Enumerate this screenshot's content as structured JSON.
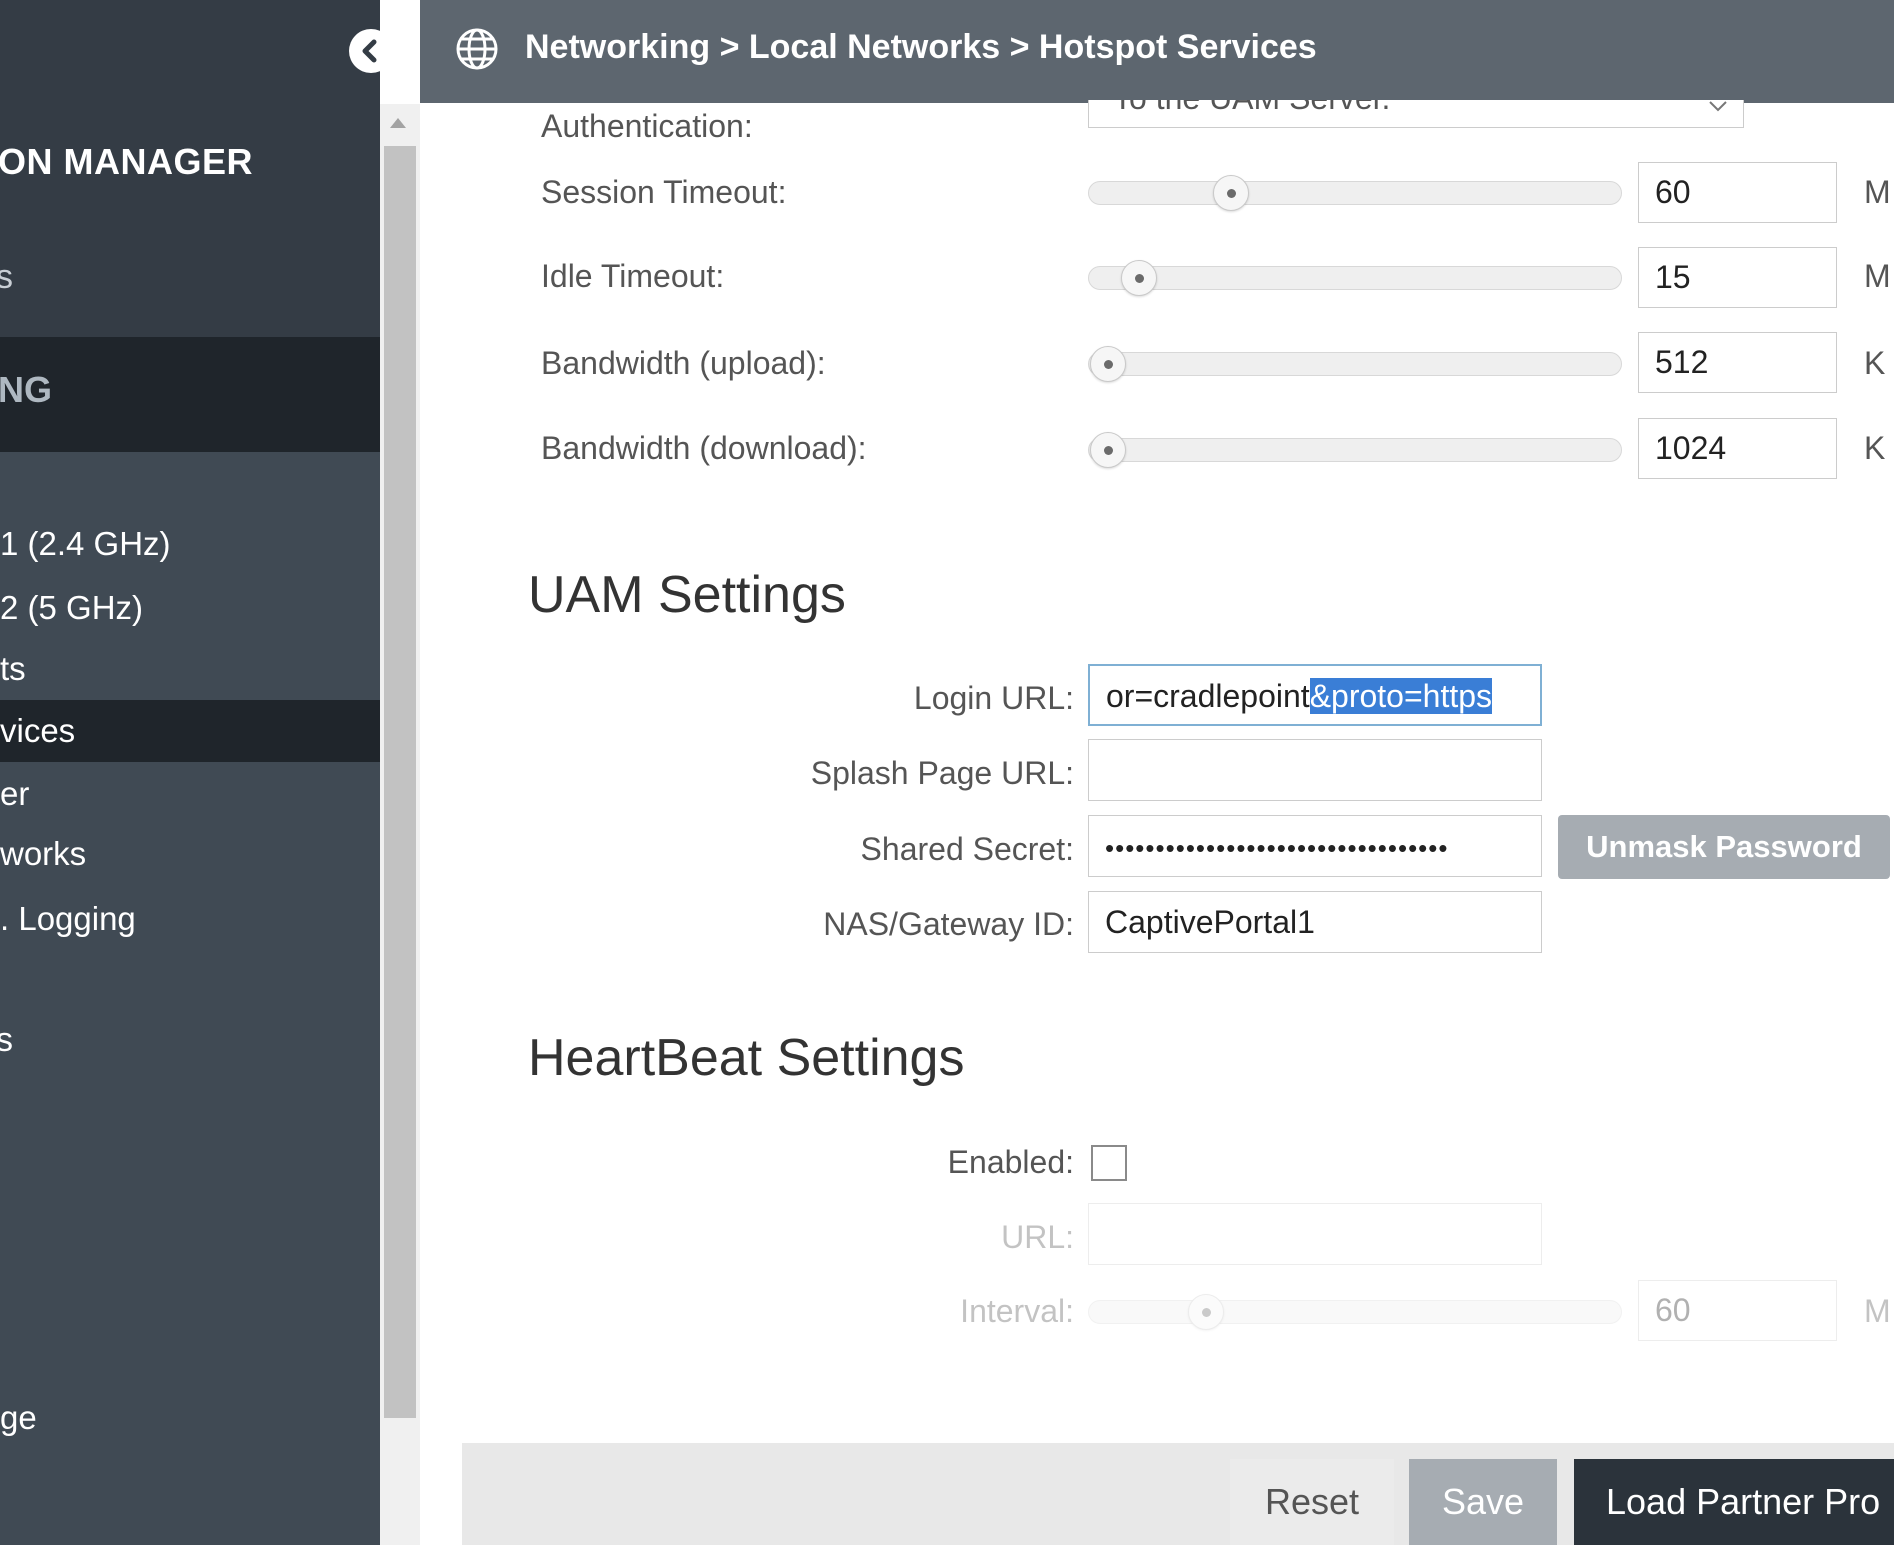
{
  "sidebar": {
    "app_title": "ON MANAGER",
    "fragment_top": "s",
    "section": "NG",
    "items": [
      {
        "label": "1 (2.4 GHz)",
        "active": false
      },
      {
        "label": "2 (5 GHz)",
        "active": false
      },
      {
        "label": "ts",
        "active": false
      },
      {
        "label": "vices",
        "active": true
      },
      {
        "label": "er",
        "active": false
      },
      {
        "label": "works",
        "active": false
      },
      {
        "label": ". Logging",
        "active": false
      }
    ],
    "fragment_mid": "s",
    "fragment_bottom": "ge"
  },
  "header": {
    "breadcrumb": "Networking > Local Networks > Hotspot Services"
  },
  "auth": {
    "label": "Authentication:",
    "select_value": "To the UAM Server."
  },
  "sliders": [
    {
      "label": "Session Timeout:",
      "value": "60",
      "unit": "M",
      "level": 0.27
    },
    {
      "label": "Idle Timeout:",
      "value": "15",
      "unit": "M",
      "level": 0.09
    },
    {
      "label": "Bandwidth (upload):",
      "value": "512",
      "unit": "K",
      "level": 0.03
    },
    {
      "label": "Bandwidth (download):",
      "value": "1024",
      "unit": "K",
      "level": 0.03
    }
  ],
  "uam": {
    "heading": "UAM Settings",
    "login_url_label": "Login URL:",
    "login_url_plain": "or=cradlepoint",
    "login_url_selected": "&proto=https",
    "splash_label": "Splash Page URL:",
    "splash_value": "",
    "secret_label": "Shared Secret:",
    "secret_value": "••••••••••••••••••••••••••••••••••",
    "unmask_button": "Unmask Password",
    "nas_label": "NAS/Gateway ID:",
    "nas_value": "CaptivePortal1"
  },
  "heartbeat": {
    "heading": "HeartBeat Settings",
    "enabled_label": "Enabled:",
    "enabled_checked": false,
    "url_label": "URL:",
    "url_value": "",
    "interval_label": "Interval:",
    "interval_value": "60",
    "interval_unit": "M",
    "interval_level": 0.21
  },
  "footer": {
    "reset": "Reset",
    "save": "Save",
    "load_partner": "Load Partner Pro"
  },
  "colors": {
    "sidebar_bg": "#404a54",
    "sidebar_active": "#1f252b",
    "header_bg": "#5d666f",
    "selection": "#3a7ed6",
    "button_gray": "#a6acb2",
    "button_dark": "#2b333b"
  }
}
